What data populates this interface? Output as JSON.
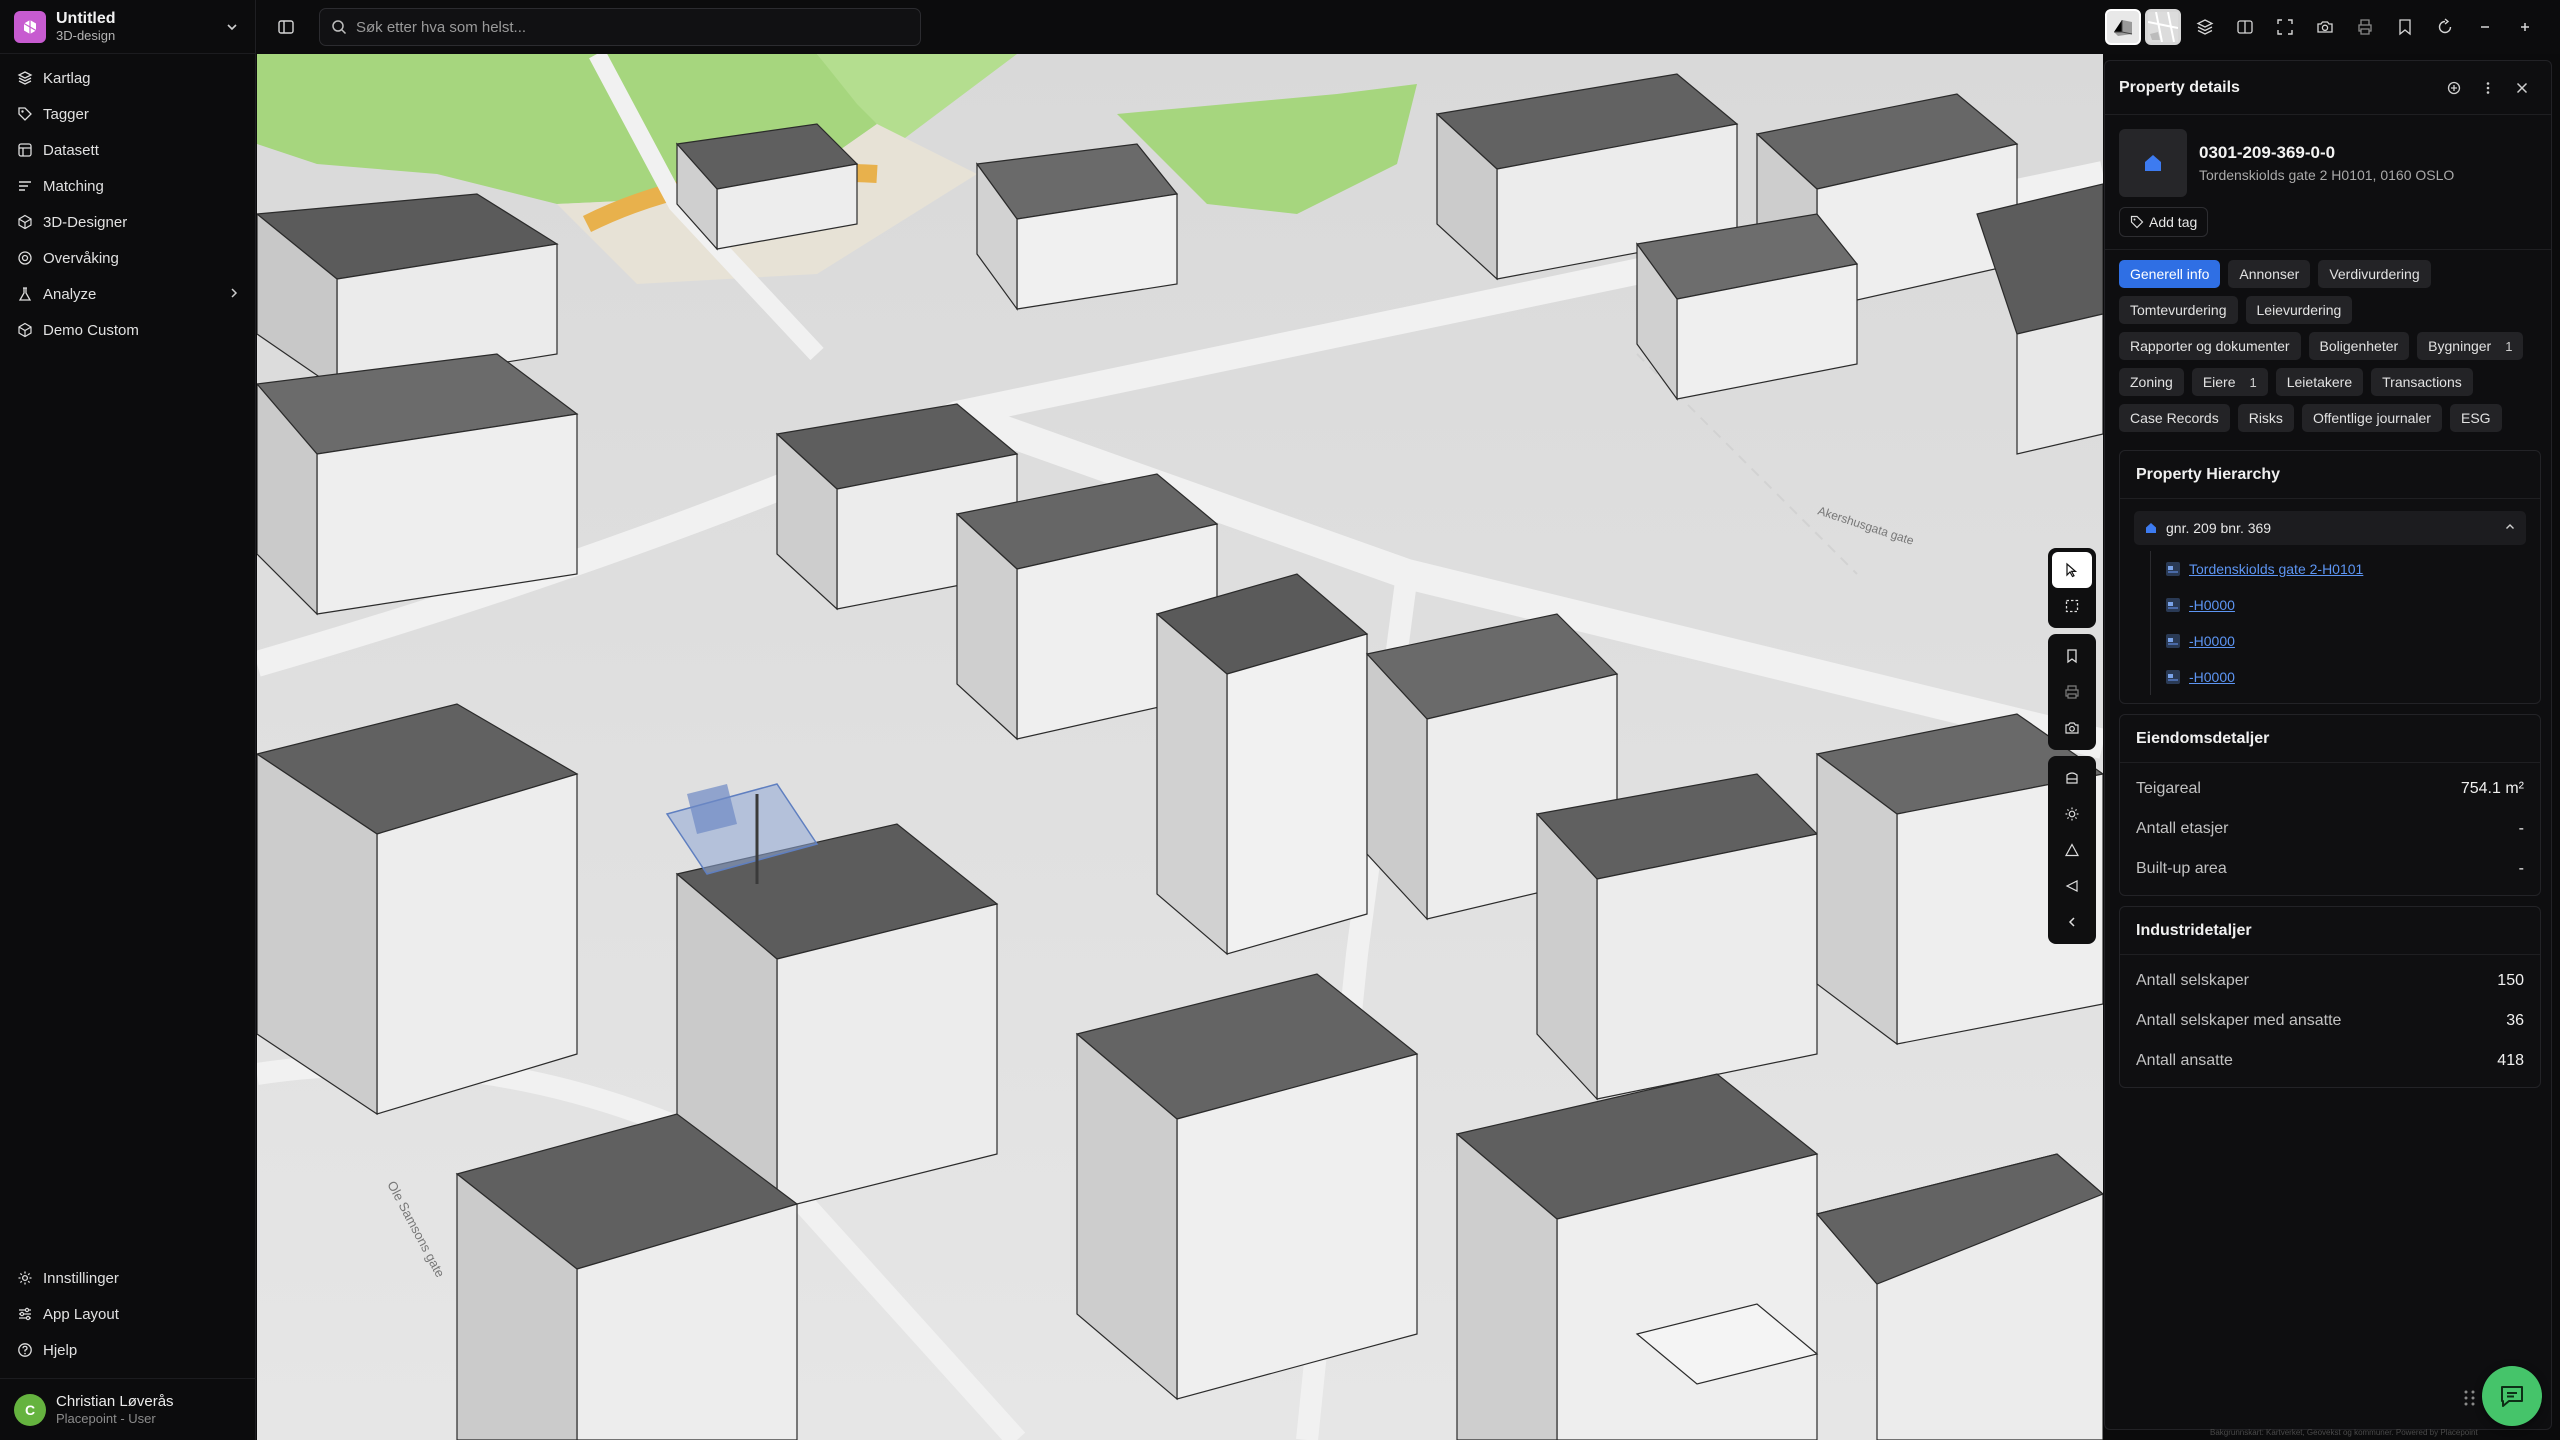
{
  "workspace": {
    "name": "Untitled",
    "subtitle": "3D-design"
  },
  "sidebar": {
    "items": [
      {
        "label": "Kartlag",
        "icon": "layers-icon"
      },
      {
        "label": "Tagger",
        "icon": "tag-icon"
      },
      {
        "label": "Datasett",
        "icon": "dataset-icon"
      },
      {
        "label": "Matching",
        "icon": "list-icon"
      },
      {
        "label": "3D-Designer",
        "icon": "cube-icon"
      },
      {
        "label": "Overvåking",
        "icon": "monitor-icon"
      },
      {
        "label": "Analyze",
        "icon": "flask-icon"
      },
      {
        "label": "Demo Custom",
        "icon": "cube-icon"
      }
    ],
    "bottom_items": [
      {
        "label": "Innstillinger",
        "icon": "gear-icon"
      },
      {
        "label": "App Layout",
        "icon": "sliders-icon"
      },
      {
        "label": "Hjelp",
        "icon": "help-icon"
      }
    ]
  },
  "user": {
    "initial": "C",
    "name": "Christian Løverås",
    "role": "Placepoint - User"
  },
  "search": {
    "placeholder": "Søk etter hva som helst..."
  },
  "panel": {
    "title": "Property details",
    "property_id": "0301-209-369-0-0",
    "address": "Tordenskiolds gate 2 H0101, 0160 OSLO",
    "add_tag_label": "Add tag",
    "tabs": [
      {
        "label": "Generell info",
        "active": true
      },
      {
        "label": "Annonser"
      },
      {
        "label": "Verdivurdering"
      },
      {
        "label": "Tomtevurdering"
      },
      {
        "label": "Leievurdering"
      },
      {
        "label": "Rapporter og dokumenter"
      },
      {
        "label": "Boligenheter"
      },
      {
        "label": "Bygninger",
        "count": "1"
      },
      {
        "label": "Zoning"
      },
      {
        "label": "Eiere",
        "count": "1"
      },
      {
        "label": "Leietakere"
      },
      {
        "label": "Transactions"
      },
      {
        "label": "Case Records"
      },
      {
        "label": "Risks"
      },
      {
        "label": "Offentlige journaler"
      },
      {
        "label": "ESG"
      }
    ],
    "hierarchy": {
      "title": "Property Hierarchy",
      "root": "gnr. 209 bnr. 369",
      "children": [
        "Tordenskiolds gate 2-H0101",
        "-H0000",
        "-H0000",
        "-H0000"
      ]
    },
    "eiendom": {
      "title": "Eiendomsdetaljer",
      "rows": [
        {
          "k": "Teigareal",
          "v": "754.1 m²"
        },
        {
          "k": "Antall etasjer",
          "v": "-"
        },
        {
          "k": "Built-up area",
          "v": "-"
        }
      ]
    },
    "industri": {
      "title": "Industridetaljer",
      "rows": [
        {
          "k": "Antall selskaper",
          "v": "150"
        },
        {
          "k": "Antall selskaper med ansatte",
          "v": "36"
        },
        {
          "k": "Antall ansatte",
          "v": "418"
        }
      ]
    }
  },
  "map": {
    "street_label_1": "Akershusgata gate",
    "street_label_2": "Ole Samsons gate",
    "attribution": "Bakgrunnskart: Kartverket, Geovekst og kommuner. Powered by Placepoint"
  },
  "colors": {
    "accent": "#2f6fe4",
    "link": "#5d95f3",
    "chat": "#45c46a",
    "park": "#9fd577",
    "logo": "#c75bd0"
  }
}
